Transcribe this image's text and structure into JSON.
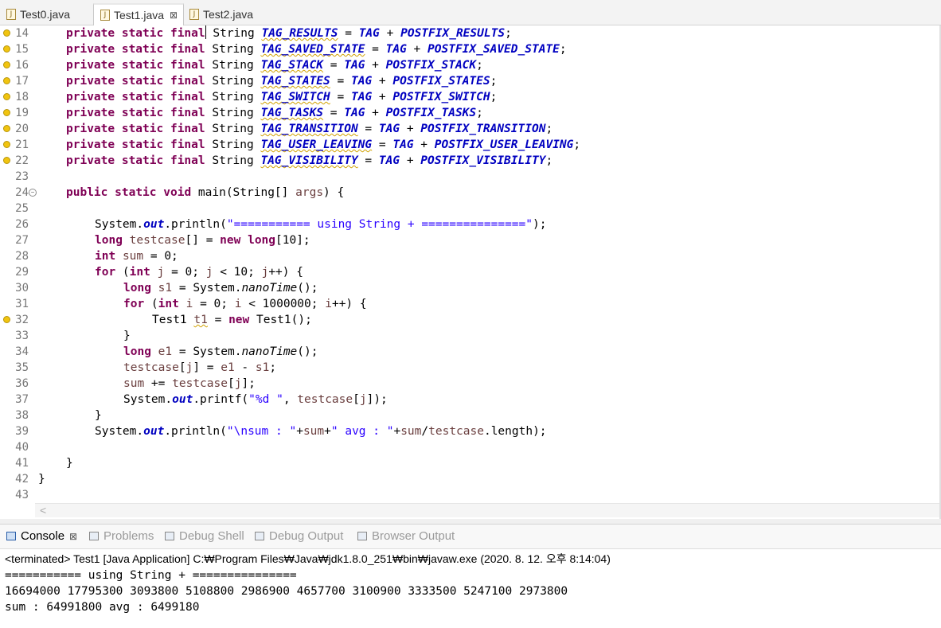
{
  "tabs": [
    {
      "label": "Test0.java",
      "active": false
    },
    {
      "label": "Test1.java",
      "active": true,
      "close": "⊠"
    },
    {
      "label": "Test2.java",
      "active": false
    }
  ],
  "editor": {
    "line_numbers": [
      "14",
      "15",
      "16",
      "17",
      "18",
      "19",
      "20",
      "21",
      "22",
      "23",
      "24",
      "25",
      "26",
      "27",
      "28",
      "29",
      "30",
      "31",
      "32",
      "33",
      "34",
      "35",
      "36",
      "37",
      "38",
      "39",
      "40",
      "41",
      "42",
      "43"
    ]
  },
  "console": {
    "tabs": [
      "Console",
      "Problems",
      "Debug Shell",
      "Debug Output",
      "Browser Output"
    ],
    "status": "<terminated> Test1 [Java Application] C:₩Program Files₩Java₩jdk1.8.0_251₩bin₩javaw.exe (2020. 8. 12. 오후 8:14:04)",
    "output": [
      "=========== using String + ===============",
      "16694000 17795300 3093800 5108800 2986900 4657700 3100900 3333500 5247100 2973800",
      "sum : 64991800 avg : 6499180"
    ]
  },
  "colors": {
    "keyword": "#7f0055",
    "field": "#0000c0",
    "string": "#2a00ff",
    "local": "#6a3e3e"
  }
}
